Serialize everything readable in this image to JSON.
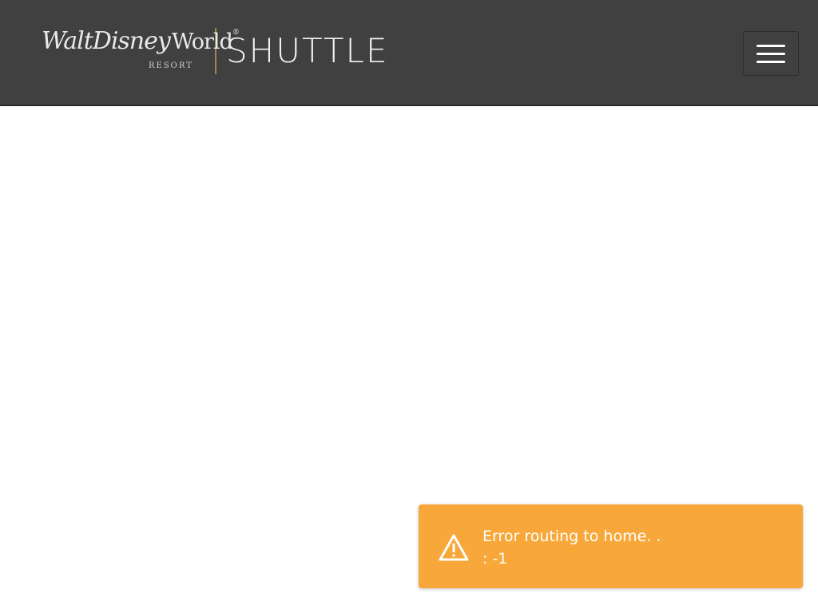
{
  "header": {
    "logo": {
      "script_text": "WaltDisney",
      "world_text": "World",
      "registered_mark": "®",
      "resort_text": "RESORT"
    },
    "app_name": "SHUTTLE",
    "menu_icon": "hamburger-menu-icon",
    "background_color": "#404040",
    "divider_color": "#9a8752"
  },
  "toast": {
    "type": "warning",
    "icon": "warning-triangle-icon",
    "message_line1": "Error routing to home. .",
    "message_line2": ": -1",
    "background_color": "#f8a83a"
  }
}
